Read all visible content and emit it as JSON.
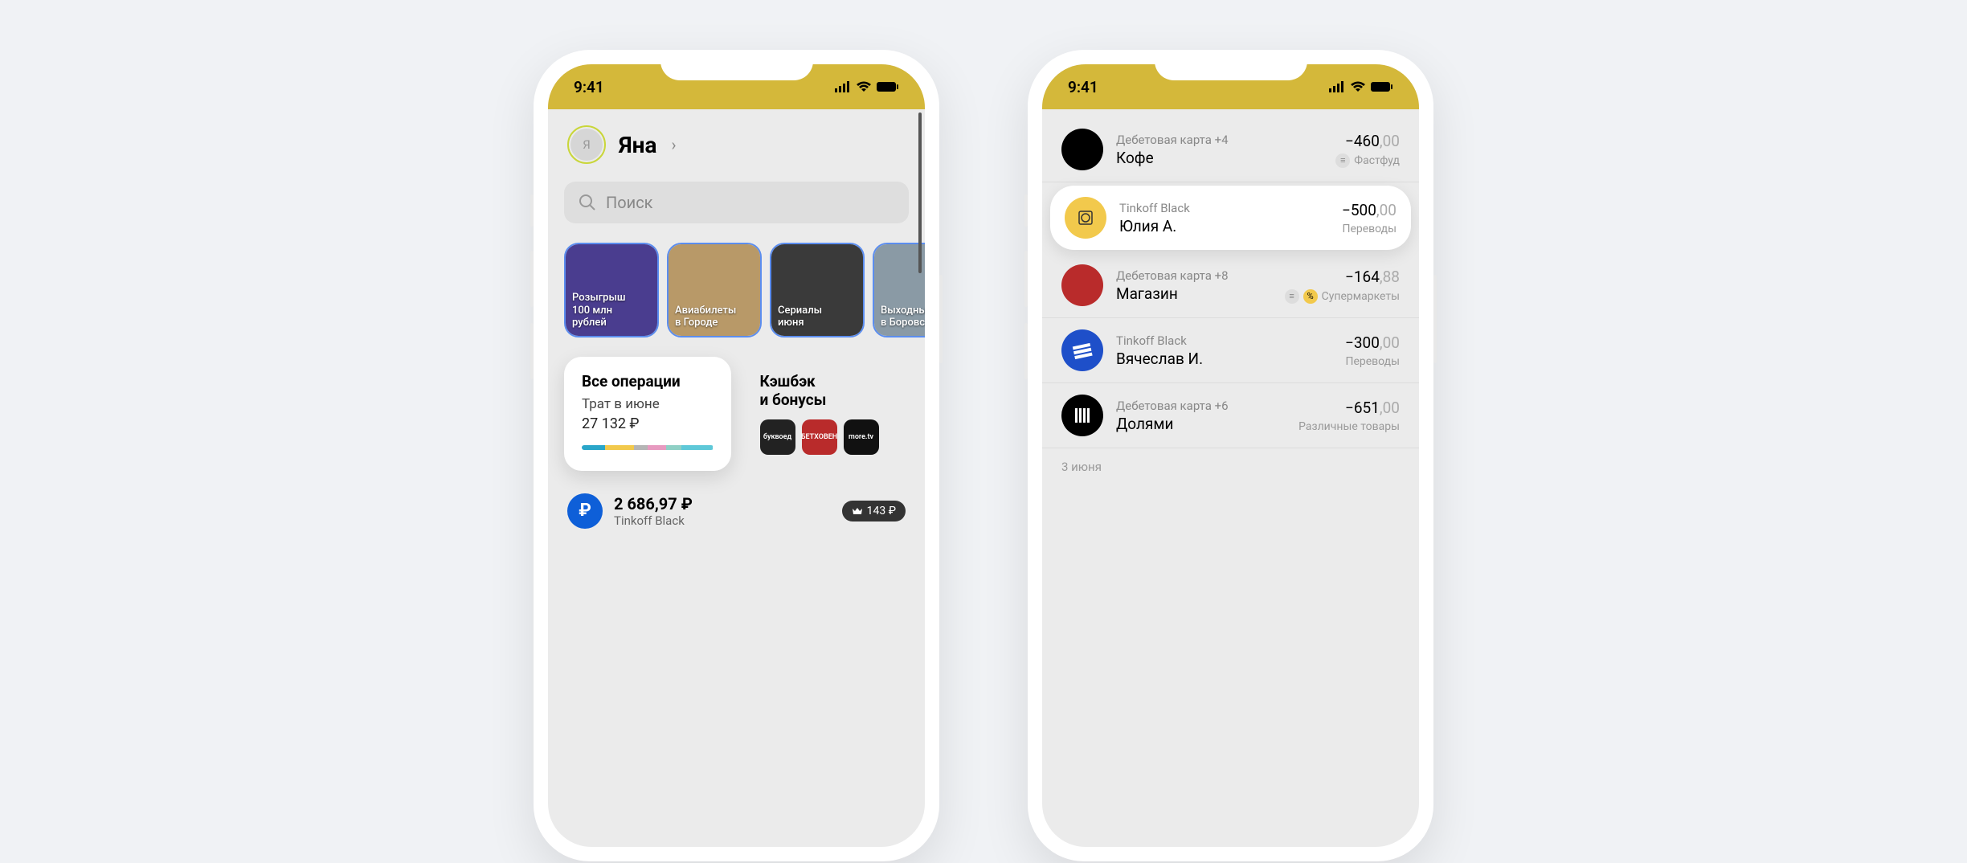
{
  "status": {
    "time": "9:41"
  },
  "left": {
    "user": {
      "initial": "Я",
      "name": "Яна"
    },
    "search_placeholder": "Поиск",
    "stories": [
      {
        "line1": "Розыгрыш",
        "line2": "100 млн",
        "line3": "рублей",
        "bg": "#4a3d8f"
      },
      {
        "line1": "Авиабилеты",
        "line2": "в Городе",
        "bg": "#b89968"
      },
      {
        "line1": "Сериалы",
        "line2": "июня",
        "bg": "#3a3a3a"
      },
      {
        "line1": "Выходные",
        "line2": "в Боровске",
        "bg": "#8a9aa5"
      }
    ],
    "ops": {
      "title": "Все операции",
      "subtitle": "Трат в июне",
      "amount": "27 132 ₽"
    },
    "cashback": {
      "title_line1": "Кэшбэк",
      "title_line2": "и бонусы",
      "icons": [
        {
          "label": "буквоед",
          "bg": "#222"
        },
        {
          "label": "БЕТХОВЕН",
          "bg": "#b92b2b"
        },
        {
          "label": "more.tv",
          "bg": "#111"
        }
      ]
    },
    "spend_segments": [
      {
        "color": "#2aa6c9",
        "w": 18
      },
      {
        "color": "#f2c94c",
        "w": 22
      },
      {
        "color": "#b5b5b5",
        "w": 10
      },
      {
        "color": "#e79ac0",
        "w": 14
      },
      {
        "color": "#8fd0c5",
        "w": 12
      },
      {
        "color": "#5ec8d8",
        "w": 24
      }
    ],
    "account": {
      "balance": "2 686,97 ₽",
      "name": "Tinkoff Black",
      "loyalty": "143 ₽"
    }
  },
  "right": {
    "transactions": [
      {
        "source": "Дебетовая карта",
        "extra": "+4",
        "title": "Кофе",
        "int": "−460",
        "cents": ",00",
        "category": "Фастфуд",
        "icon_bg": "#000",
        "badges": [
          "receipt"
        ],
        "highlight": false
      },
      {
        "source": "Tinkoff Black",
        "extra": "",
        "title": "Юлия А.",
        "int": "−500",
        "cents": ",00",
        "category": "Переводы",
        "icon_bg": "#f2c94c",
        "badges": [],
        "highlight": true,
        "icon_style": "tinkoff"
      },
      {
        "source": "Дебетовая карта",
        "extra": "+8",
        "title": "Магазин",
        "int": "−164",
        "cents": ",88",
        "category": "Супермаркеты",
        "icon_bg": "#b92b2b",
        "badges": [
          "receipt",
          "percent"
        ],
        "highlight": false
      },
      {
        "source": "Tinkoff Black",
        "extra": "",
        "title": "Вячеслав И.",
        "int": "−300",
        "cents": ",00",
        "category": "Переводы",
        "icon_bg": "#1e4fc9",
        "badges": [],
        "highlight": false,
        "icon_style": "stripes"
      },
      {
        "source": "Дебетовая карта",
        "extra": "+6",
        "title": "Долями",
        "int": "−651",
        "cents": ",00",
        "category": "Различные товары",
        "icon_bg": "#000",
        "badges": [],
        "highlight": false,
        "icon_style": "bars"
      }
    ],
    "date_sep": "3 июня"
  }
}
